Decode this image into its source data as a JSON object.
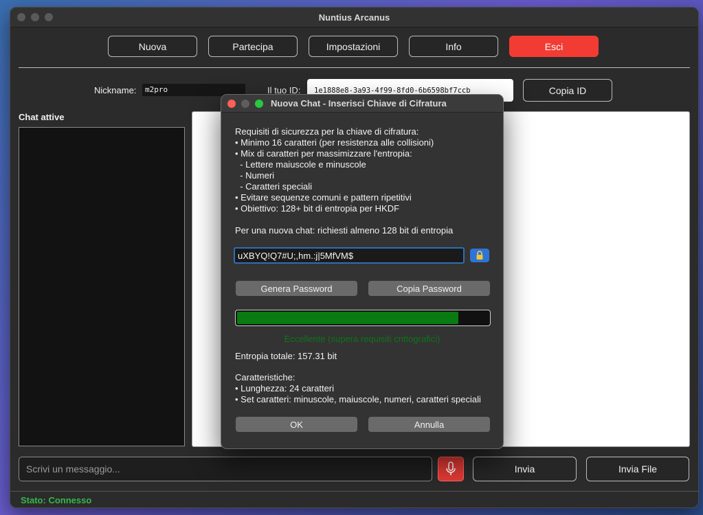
{
  "window": {
    "title": "Nuntius Arcanus"
  },
  "toolbar": {
    "buttons": [
      {
        "label": "Nuova"
      },
      {
        "label": "Partecipa"
      },
      {
        "label": "Impostazioni"
      },
      {
        "label": "Info"
      },
      {
        "label": "Esci"
      }
    ]
  },
  "identity": {
    "nickname_label": "Nickname:",
    "nickname_value": "m2pro",
    "id_label": "Il tuo ID:",
    "id_value": "1e1888e8-3a93-4f99-8fd0-6b6598bf7ccb",
    "copy_id_label": "Copia ID"
  },
  "sidebar": {
    "title": "Chat attive"
  },
  "composer": {
    "placeholder": "Scrivi un messaggio...",
    "send_label": "Invia",
    "send_file_label": "Invia File"
  },
  "status": {
    "text": "Stato: Connesso",
    "color": "#35b84a"
  },
  "dialog": {
    "title": "Nuova Chat - Inserisci Chiave di Cifratura",
    "requirements": [
      "Requisiti di sicurezza per la chiave di cifratura:",
      "• Minimo 16 caratteri (per resistenza alle collisioni)",
      "• Mix di caratteri per massimizzare l'entropia:",
      "  - Lettere maiuscole e minuscole",
      "  - Numeri",
      "  - Caratteri speciali",
      "• Evitare sequenze comuni e pattern ripetitivi",
      "• Obiettivo: 128+ bit di entropia per HKDF"
    ],
    "note": "Per una nuova chat: richiesti almeno 128 bit di entropia",
    "key_value": "uXBYQ!Q7#U;,hm.:j|5MfVM$",
    "generate_label": "Genera Password",
    "copy_label": "Copia Password",
    "strength_fraction": 0.88,
    "strength_text": "Eccellente (supera requisiti crittografici)",
    "entropy_text": "Entropia totale: 157.31 bit",
    "characteristics_title": "Caratteristiche:",
    "length_text": "• Lunghezza: 24 caratteri",
    "charset_text": "• Set caratteri: minuscole, maiuscole, numeri, caratteri speciali",
    "ok_label": "OK",
    "cancel_label": "Annulla"
  },
  "colors": {
    "accent": "#2e6fb5",
    "danger": "#f23c33",
    "strength_bar": "#0a7a12"
  }
}
